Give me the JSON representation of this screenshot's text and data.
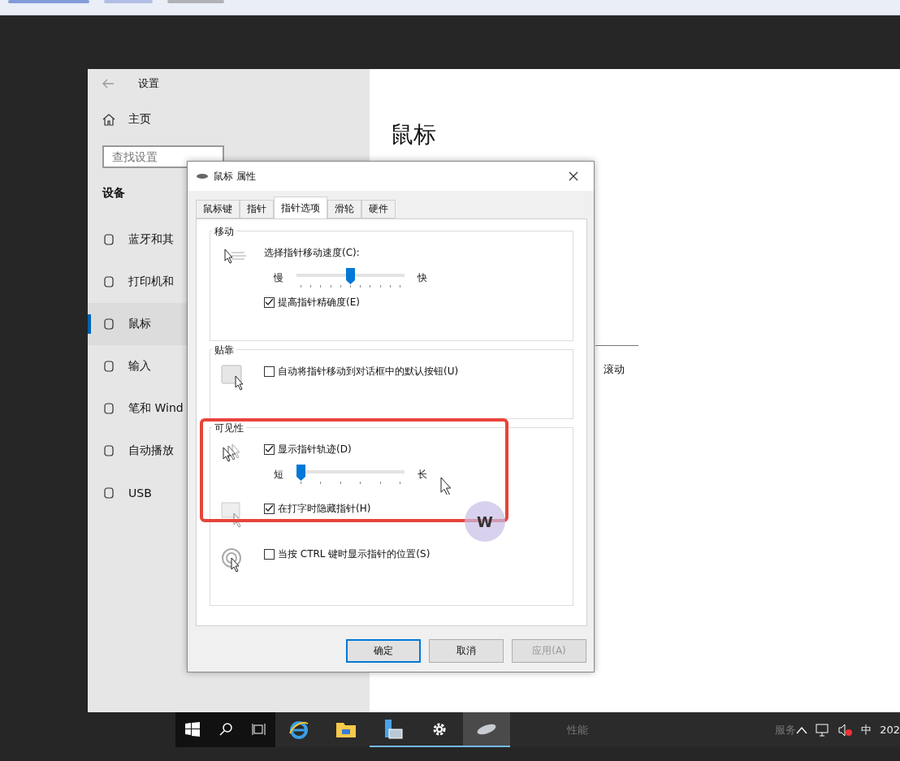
{
  "settings": {
    "title": "设置",
    "home": "主页",
    "search": {
      "placeholder": "查找设置"
    },
    "section": "设备",
    "nav": [
      {
        "label": "蓝牙和其",
        "selected": false
      },
      {
        "label": "打印机和",
        "selected": false
      },
      {
        "label": "鼠标",
        "selected": true
      },
      {
        "label": "输入",
        "selected": false
      },
      {
        "label": "笔和 Wind",
        "selected": false
      },
      {
        "label": "自动播放",
        "selected": false
      },
      {
        "label": "USB",
        "selected": false
      }
    ],
    "page_title": "鼠标",
    "page_text": "滚动"
  },
  "dialog": {
    "title": "鼠标 属性",
    "tabs": [
      {
        "label": "鼠标键",
        "selected": false
      },
      {
        "label": "指针",
        "selected": false
      },
      {
        "label": "指针选项",
        "selected": true
      },
      {
        "label": "滑轮",
        "selected": false
      },
      {
        "label": "硬件",
        "selected": false
      }
    ],
    "groups": [
      {
        "title": "移动",
        "blocks": [
          [
            {
              "kind": "label",
              "text": "选择指针移动速度(C):"
            },
            {
              "kind": "slider",
              "min_label": "慢",
              "max_label": "快",
              "level": 0.5
            },
            {
              "kind": "checkbox",
              "label": "提高指针精确度(E)",
              "checked": true
            }
          ]
        ]
      },
      {
        "title": "贴靠",
        "blocks": [
          [
            {
              "kind": "checkbox",
              "label": "自动将指针移动到对话框中的默认按钮(U)",
              "checked": false
            }
          ]
        ]
      },
      {
        "title": "可见性",
        "blocks": [
          [
            {
              "kind": "checkbox",
              "label": "显示指针轨迹(D)",
              "checked": true
            },
            {
              "kind": "slider",
              "min_label": "短",
              "max_label": "长",
              "level": 0
            }
          ],
          [
            {
              "kind": "checkbox",
              "label": "在打字时隐藏指针(H)",
              "checked": true
            }
          ],
          [
            {
              "kind": "checkbox",
              "label": "当按 CTRL 键时显示指针的位置(S)",
              "checked": false
            }
          ]
        ]
      }
    ],
    "buttons": [
      {
        "label": "确定",
        "default": true,
        "disabled": false
      },
      {
        "label": "取消",
        "default": false,
        "disabled": false
      },
      {
        "label": "应用(A)",
        "default": false,
        "disabled": true
      }
    ]
  },
  "highlight_badge": "W",
  "taskbar": {
    "apps": [
      {
        "kind": "start",
        "running": false,
        "selected": false
      },
      {
        "kind": "search",
        "running": false,
        "selected": false
      },
      {
        "kind": "taskview",
        "running": false,
        "selected": false
      },
      {
        "kind": "browser",
        "running": false,
        "selected": false
      },
      {
        "kind": "folder",
        "running": false,
        "selected": false
      },
      {
        "kind": "server",
        "running": true,
        "selected": false
      },
      {
        "kind": "gear",
        "running": true,
        "selected": false
      },
      {
        "kind": "mouse",
        "running": true,
        "selected": true
      }
    ],
    "background_texts": [
      "性能",
      "服务"
    ],
    "ime": "中",
    "clock": "202"
  }
}
